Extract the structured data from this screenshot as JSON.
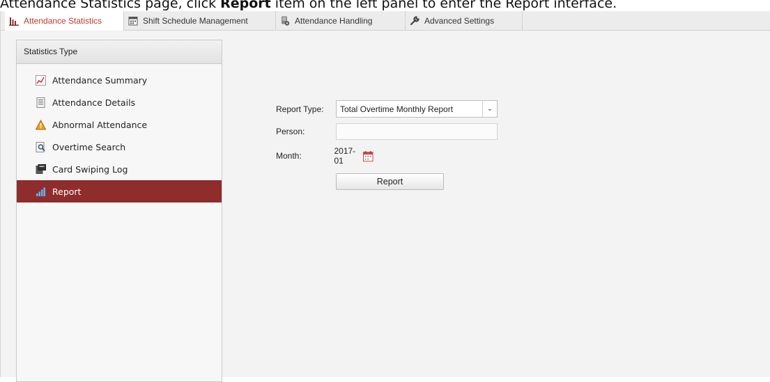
{
  "caption": {
    "part1": "Attendance Statistics page, click ",
    "bold": "Report",
    "part2": " item on the left panel to enter the Report interface."
  },
  "tabs": [
    {
      "label": "Attendance Statistics",
      "icon": "bar-chart-icon"
    },
    {
      "label": "Shift Schedule Management",
      "icon": "calendar-icon"
    },
    {
      "label": "Attendance Handling",
      "icon": "document-gear-icon"
    },
    {
      "label": "Advanced Settings",
      "icon": "wrench-icon"
    }
  ],
  "left_panel": {
    "header": "Statistics Type",
    "items": [
      {
        "label": "Attendance Summary",
        "icon": "summary-chart-icon"
      },
      {
        "label": "Attendance Details",
        "icon": "details-document-icon"
      },
      {
        "label": "Abnormal Attendance",
        "icon": "warning-person-icon"
      },
      {
        "label": "Overtime Search",
        "icon": "search-document-icon"
      },
      {
        "label": "Card Swiping Log",
        "icon": "card-log-icon"
      },
      {
        "label": "Report",
        "icon": "report-bars-icon"
      }
    ],
    "selected": "Report"
  },
  "form": {
    "report_type_label": "Report Type:",
    "report_type_value": "Total Overtime Monthly Report",
    "person_label": "Person:",
    "person_value": "",
    "month_label": "Month:",
    "month_value": "2017-01",
    "report_button": "Report"
  },
  "colors": {
    "selected_bg": "#8f2c2c",
    "active_tab_text": "#c0392b"
  }
}
